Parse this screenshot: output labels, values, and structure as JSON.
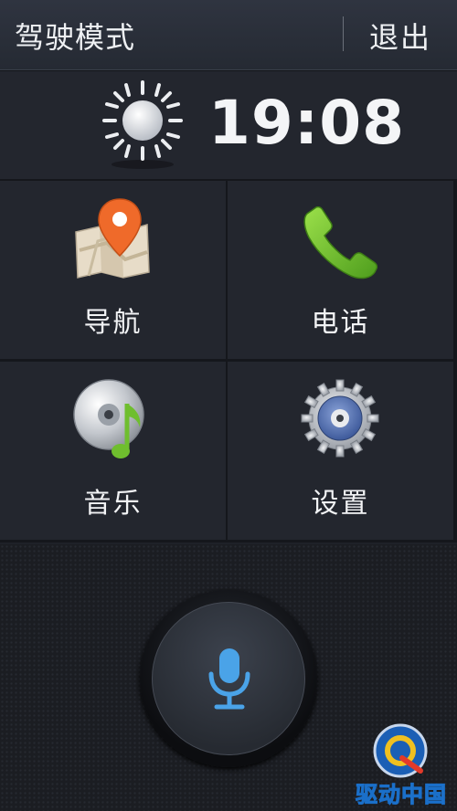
{
  "header": {
    "title": "驾驶模式",
    "exit_label": "退出"
  },
  "clock": {
    "time": "19:08",
    "weather_icon": "sun-icon"
  },
  "apps": [
    {
      "label": "导航",
      "icon": "map-pin-icon"
    },
    {
      "label": "电话",
      "icon": "phone-icon"
    },
    {
      "label": "音乐",
      "icon": "music-disc-icon"
    },
    {
      "label": "设置",
      "icon": "gear-icon"
    }
  ],
  "voice": {
    "icon": "microphone-icon",
    "accent": "#4aa3e8"
  },
  "watermark": {
    "text": "驱动中国",
    "logo": "q-logo"
  }
}
